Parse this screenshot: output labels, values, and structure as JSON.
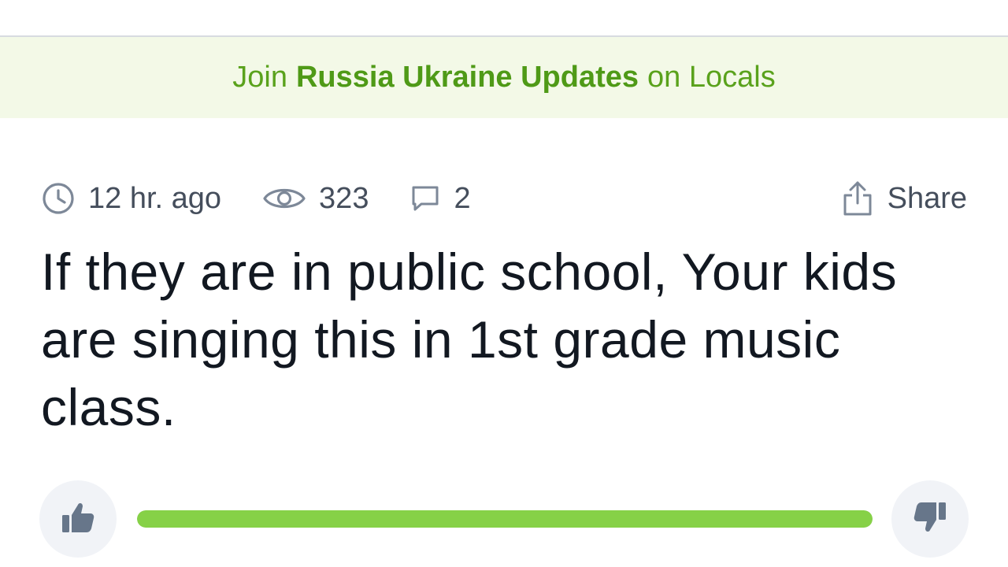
{
  "banner": {
    "prefix": "Join",
    "community": "Russia Ukraine Updates",
    "suffix": "on Locals"
  },
  "post": {
    "time": "12 hr. ago",
    "views": "323",
    "comments": "2",
    "share_label": "Share",
    "title": "If they are in public school, Your kids are singing this in 1st grade music class."
  },
  "votes": {
    "upvote_ratio": 1.0
  },
  "colors": {
    "accent_green": "#5aa21c",
    "vote_bar_green": "#86d147",
    "icon_gray": "#7d8898",
    "vote_icon_gray": "#67768a"
  },
  "icons": {
    "time": "clock-icon",
    "views": "eye-icon",
    "comments": "comment-icon",
    "share": "share-upload-icon",
    "upvote": "thumbs-up-icon",
    "downvote": "thumbs-down-icon"
  }
}
